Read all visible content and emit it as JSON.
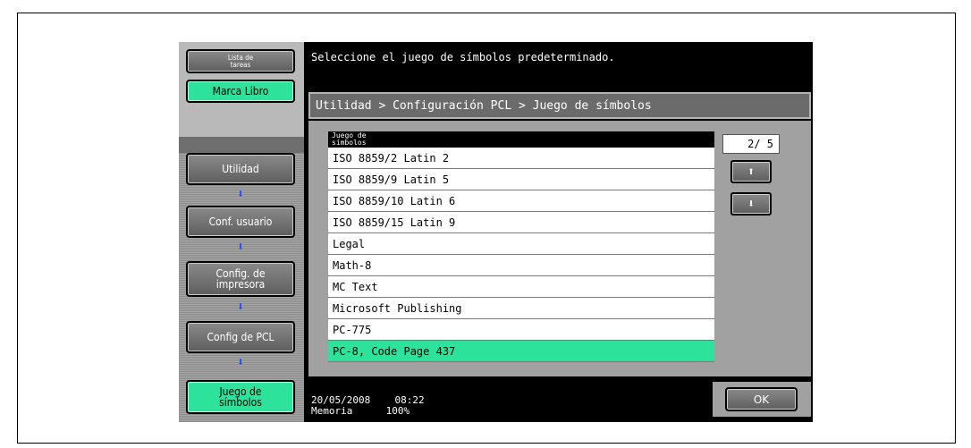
{
  "sidebar": {
    "lista_label": "Lista de tareas",
    "marca_label": "Marca Libro",
    "nav": [
      {
        "label": "Utilidad"
      },
      {
        "label": "Conf. usuario"
      },
      {
        "label": "Config. de impresora"
      },
      {
        "label": "Config de PCL"
      },
      {
        "label": "Juego de símbolos"
      }
    ],
    "arrow": "⬇"
  },
  "header": {
    "message": "Seleccione el juego de símbolos predeterminado."
  },
  "breadcrumb": "Utilidad > Configuración PCL > Juego de símbolos",
  "list": {
    "header": "Juego de símbolos",
    "items": [
      "ISO 8859/2 Latin 2",
      "ISO 8859/9 Latin 5",
      "ISO 8859/10 Latin 6",
      "ISO 8859/15 Latin 9",
      "Legal",
      "Math-8",
      "MC Text",
      "Microsoft Publishing",
      "PC-775",
      "PC-8, Code Page 437"
    ],
    "selected_index": 9
  },
  "pager": {
    "text": "2/ 5",
    "up": "⬆",
    "down": "⬇"
  },
  "footer": {
    "date": "20/05/2008",
    "time": "08:22",
    "memory_label": "Memoria",
    "memory_value": "100%"
  },
  "ok_label": "OK",
  "colors": {
    "accent_green": "#2de39c",
    "arrow_blue": "#1a4cff"
  }
}
